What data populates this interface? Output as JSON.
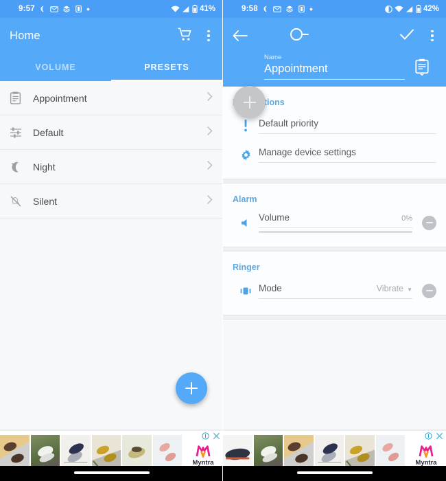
{
  "left": {
    "statusbar": {
      "time": "9:57",
      "battery": "41%",
      "icons": [
        "moon-icon",
        "mail-icon",
        "layers-icon",
        "clipboard-icon",
        "dot-icon"
      ],
      "right_icons": [
        "wifi-icon",
        "signal-icon",
        "battery-icon"
      ]
    },
    "appbar": {
      "title": "Home",
      "actions": [
        "cart-icon",
        "overflow-menu-icon"
      ]
    },
    "tabs": [
      {
        "label": "VOLUME",
        "active": false
      },
      {
        "label": "PRESETS",
        "active": true
      }
    ],
    "presets": [
      {
        "label": "Appointment",
        "icon": "clipboard-icon"
      },
      {
        "label": "Default",
        "icon": "sliders-icon"
      },
      {
        "label": "Night",
        "icon": "moon-icon"
      },
      {
        "label": "Silent",
        "icon": "bell-off-icon"
      }
    ],
    "fab": {
      "icon": "plus-icon"
    }
  },
  "right": {
    "statusbar": {
      "time": "9:58",
      "battery": "42%",
      "icons": [
        "moon-icon",
        "mail-icon",
        "layers-icon",
        "clipboard-icon",
        "dot-icon"
      ],
      "right_icons": [
        "contrast-icon",
        "wifi-icon",
        "signal-icon",
        "battery-icon"
      ]
    },
    "appbar": {
      "back": "back-arrow-icon",
      "toggle": "switch-off-icon",
      "confirm": "checkmark-icon",
      "overflow": "overflow-menu-icon"
    },
    "name": {
      "label": "Name",
      "value": "Appointment",
      "icon": "clipboard-picker-icon"
    },
    "fab": {
      "icon": "plus-icon"
    },
    "sections": [
      {
        "title": "Notifications",
        "rows": [
          {
            "label": "Default priority",
            "value": "",
            "icon": "priority-icon",
            "has_minus": false,
            "has_caret": false
          },
          {
            "label": "Manage device settings",
            "value": "",
            "icon": "gear-icon",
            "has_minus": false,
            "has_caret": false
          }
        ]
      },
      {
        "title": "Alarm",
        "rows": [
          {
            "label": "Volume",
            "value": "0%",
            "icon": "speaker-icon",
            "has_minus": true,
            "has_caret": false,
            "slider": 0
          }
        ]
      },
      {
        "title": "Ringer",
        "rows": [
          {
            "label": "Mode",
            "value": "Vibrate",
            "icon": "vibrate-icon",
            "has_minus": true,
            "has_caret": true
          }
        ]
      }
    ]
  },
  "ad": {
    "brand": "Myntra",
    "info_icon": "info-icon",
    "close_icon": "close-icon",
    "left_cells": [
      "#8C6B50",
      "#6E7B5A",
      "#3A3E55",
      "#C9A227",
      "#D8D3C4",
      "#E8A7A0"
    ],
    "right_cells": [
      "#2E3444",
      "#6E7B5A",
      "#8C6B50",
      "#3A3E55",
      "#C9A227",
      "#E8A7A0"
    ]
  },
  "colors": {
    "accent": "#54A9F8",
    "statusbar": "#4A9EF5",
    "section_title": "#5FA8DC",
    "page_bg": "#F7F8FA"
  }
}
